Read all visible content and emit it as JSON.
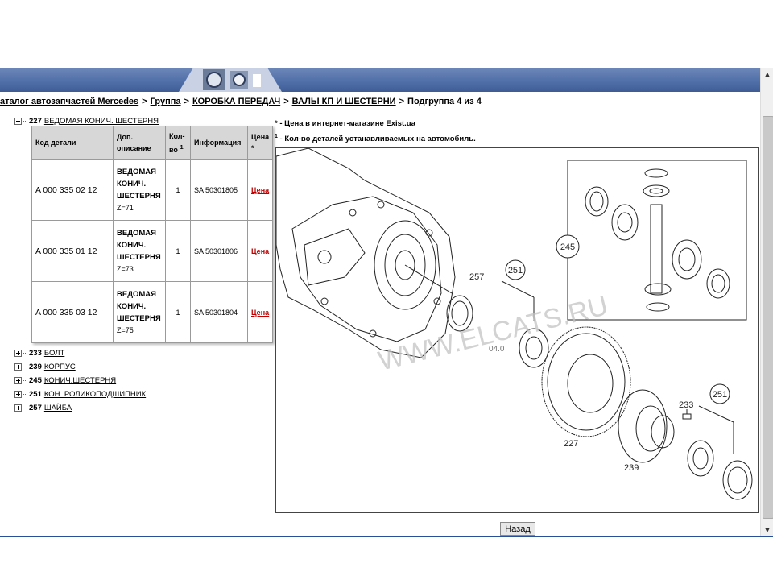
{
  "breadcrumb": {
    "root": "аталог автозапчастей Mercedes",
    "group": "Группа",
    "level1": "КОРОБКА ПЕРЕДАЧ",
    "level2": "ВАЛЫ КП И ШЕСТЕРНИ",
    "current": "Подгруппа 4 из 4",
    "separator": ">"
  },
  "tree": {
    "expanded": {
      "num": "227",
      "label": "ВЕДОМАЯ КОНИЧ. ШЕСТЕРНЯ"
    },
    "collapsed": [
      {
        "num": "233",
        "label": "БОЛТ"
      },
      {
        "num": "239",
        "label": "КОРПУС"
      },
      {
        "num": "245",
        "label": "КОНИЧ.ШЕСТЕРНЯ"
      },
      {
        "num": "251",
        "label": "КОН. РОЛИКОПОДШИПНИК"
      },
      {
        "num": "257",
        "label": "ШАЙБА"
      }
    ]
  },
  "table": {
    "headers": {
      "code": "Код детали",
      "desc": "Доп. описание",
      "qty": "Кол-во",
      "qty_sup": "1",
      "info": "Информация",
      "price": "Цена",
      "price_sup": "*"
    },
    "rows": [
      {
        "code": "A 000 335 02 12",
        "desc": "ВЕДОМАЯ КОНИЧ. ШЕСТЕРНЯ",
        "z": "Z=71",
        "qty": "1",
        "info": "SA 50301805",
        "price": "Цена"
      },
      {
        "code": "A 000 335 01 12",
        "desc": "ВЕДОМАЯ КОНИЧ. ШЕСТЕРНЯ",
        "z": "Z=73",
        "qty": "1",
        "info": "SA 50301806",
        "price": "Цена"
      },
      {
        "code": "A 000 335 03 12",
        "desc": "ВЕДОМАЯ КОНИЧ. ШЕСТЕРНЯ",
        "z": "Z=75",
        "qty": "1",
        "info": "SA 50301804",
        "price": "Цена"
      }
    ]
  },
  "notes": {
    "star_mark": "*",
    "star": " - Цена в интернет-магазине Exist.ua",
    "one_mark": "1",
    "one": " - Кол-во деталей устанавливаемых на автомобиль."
  },
  "diagram": {
    "watermark": "WWW.ELCATS.RU",
    "callouts": {
      "c245": "245",
      "c257": "257",
      "c251a": "251",
      "c227": "227",
      "c233": "233",
      "c251b": "251",
      "c239": "239",
      "c04": "04.0"
    }
  },
  "buttons": {
    "back": "Назад"
  },
  "scrollbar": {
    "up_glyph": "▲",
    "down_glyph": "▼"
  },
  "colors": {
    "banner": "#4f6ea8",
    "header_bg": "#d7d7d7",
    "price_link": "#c00000",
    "bottom_line": "#2a4f9a"
  },
  "icons": {
    "expanded_node": "minus-box-icon",
    "collapsed_node": "plus-box-icon"
  }
}
